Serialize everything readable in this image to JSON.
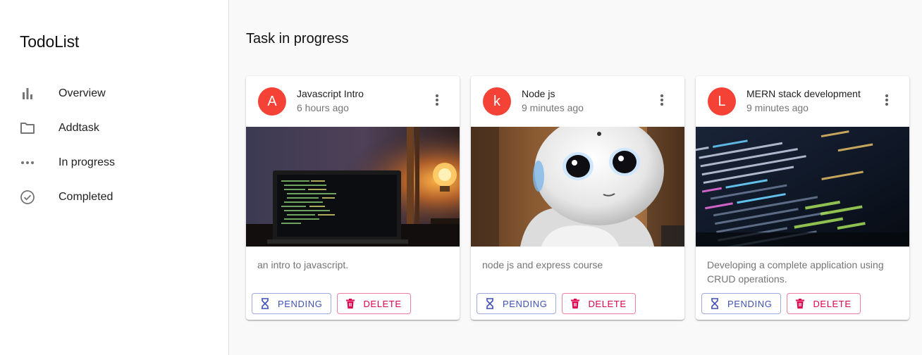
{
  "app": {
    "title": "TodoList"
  },
  "sidebar": {
    "items": [
      {
        "label": "Overview",
        "icon": "bar-chart-icon"
      },
      {
        "label": "Addtask",
        "icon": "folder-icon"
      },
      {
        "label": "In progress",
        "icon": "more-horiz-icon"
      },
      {
        "label": "Completed",
        "icon": "check-circle-icon"
      }
    ]
  },
  "main": {
    "title": "Task in progress",
    "cards": [
      {
        "avatar": "A",
        "title": "Javascript Intro",
        "time": "6 hours ago",
        "image": "laptop-with-lamp-photo",
        "description": "an intro to javascript.",
        "pending_label": "PENDING",
        "delete_label": "DELETE"
      },
      {
        "avatar": "k",
        "title": "Node js",
        "time": "9 minutes ago",
        "image": "robot-photo",
        "description": "node js and express course",
        "pending_label": "PENDING",
        "delete_label": "DELETE"
      },
      {
        "avatar": "L",
        "title": "MERN stack development",
        "time": "9 minutes ago",
        "image": "code-screen-photo",
        "description": "Developing a complete application using CRUD operations.",
        "pending_label": "PENDING",
        "delete_label": "DELETE"
      }
    ]
  },
  "colors": {
    "avatar": "#f44336",
    "primary": "#3f51b5",
    "secondary": "#dc004e"
  }
}
